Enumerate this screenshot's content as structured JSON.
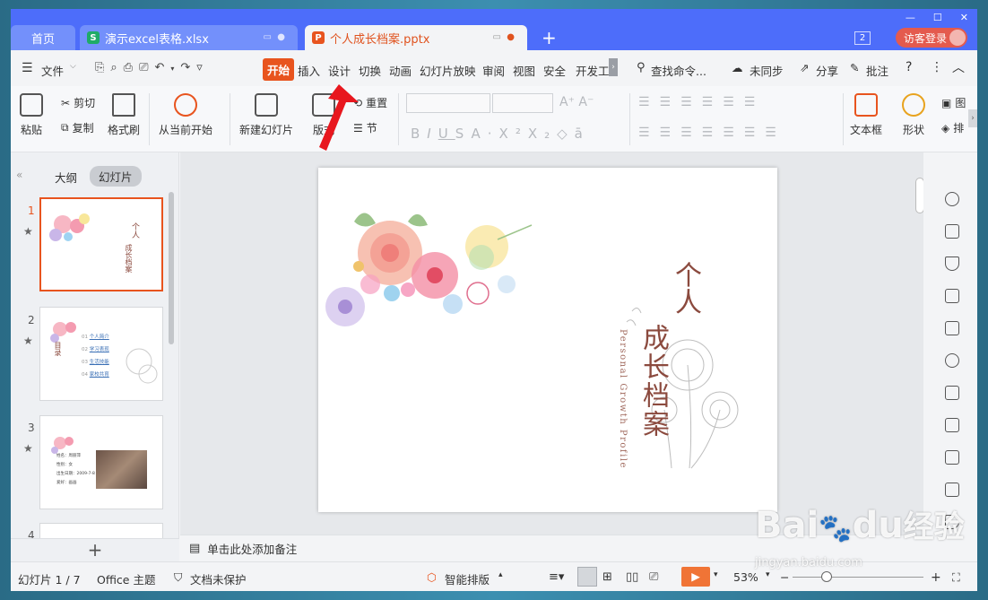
{
  "tabs": [
    {
      "label": "首页"
    },
    {
      "label": "演示excel表格.xlsx",
      "icon": "S"
    },
    {
      "label": "个人成长档案.pptx",
      "icon": "P"
    }
  ],
  "titlebar": {
    "badge": "2",
    "login": "访客登录"
  },
  "menu": {
    "file": "文件",
    "items": [
      "开始",
      "插入",
      "设计",
      "切换",
      "动画",
      "幻灯片放映",
      "审阅",
      "视图",
      "安全",
      "开发工"
    ],
    "search": "查找命令...",
    "sync": "未同步",
    "share": "分享",
    "comment": "批注"
  },
  "ribbon": {
    "paste": "粘贴",
    "cut": "剪切",
    "copy": "复制",
    "format_painter": "格式刷",
    "from_current": "从当前开始",
    "new_slide": "新建幻灯片",
    "layout": "版式",
    "reset": "重置",
    "section": "节",
    "textbox": "文本框",
    "shape": "形状",
    "picture_partial": "图",
    "arrange_partial": "排"
  },
  "sidepanel": {
    "outline": "大纲",
    "slides": "幻灯片",
    "numbers": [
      "1",
      "2",
      "3",
      "4"
    ]
  },
  "thumb2": {
    "toc": "目录",
    "items": [
      "个人简介",
      "学习表现",
      "生活技能",
      "家校共育"
    ],
    "nums": [
      "01",
      "02",
      "03",
      "04"
    ]
  },
  "thumb3": {
    "lines": [
      "姓名：周丽萍",
      "性别：女",
      "出生日期：2009-7-8",
      "爱好：画画"
    ]
  },
  "slide": {
    "title_top": "个人",
    "title_main": "成长档案",
    "subtitle": "Personal Growth Profile"
  },
  "notes": {
    "placeholder": "单击此处添加备注"
  },
  "status": {
    "slide_count": "幻灯片 1 / 7",
    "theme": "Office 主题",
    "protection": "文档未保护",
    "smart_layout": "智能排版",
    "zoom": "53%"
  },
  "watermark": {
    "brand": "Bai",
    "brand2": "du",
    "cn": "经验",
    "url": "jingyan.baidu.com"
  },
  "colors": {
    "accent": "#e8541e",
    "titlebar": "#4d6dfa",
    "title_text": "#8b4a3e"
  }
}
